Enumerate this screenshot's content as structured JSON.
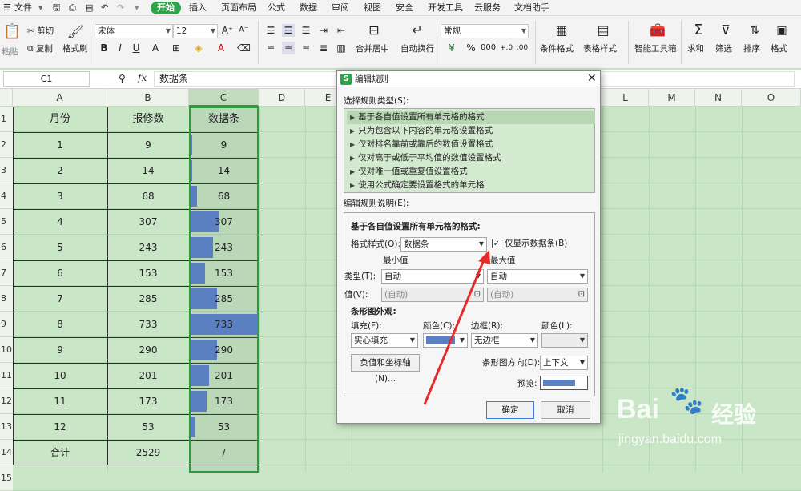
{
  "menu": {
    "file": "文件",
    "tabs": [
      "开始",
      "插入",
      "页面布局",
      "公式",
      "数据",
      "审阅",
      "视图",
      "安全",
      "开发工具",
      "云服务",
      "文档助手"
    ]
  },
  "ribbon": {
    "paste": "粘贴",
    "cut": "剪切",
    "copy": "复制",
    "format_painter": "格式刷",
    "font_name": "宋体",
    "font_size": "12",
    "merge_center": "合并居中",
    "wrap_text": "自动换行",
    "number_format": "常规",
    "conditional_format": "条件格式",
    "table_style": "表格样式",
    "smart_toolbox": "智能工具箱",
    "sum": "求和",
    "filter": "筛选",
    "sort": "排序",
    "format": "格式"
  },
  "formula_bar": {
    "cell_ref": "C1",
    "fx": "fx",
    "content": "数据条"
  },
  "sheet": {
    "columns": [
      "A",
      "B",
      "C",
      "D",
      "E",
      "L",
      "M",
      "N",
      "O"
    ],
    "rows": [
      "1",
      "2",
      "3",
      "4",
      "5",
      "6",
      "7",
      "8",
      "9",
      "10",
      "11",
      "12",
      "13",
      "14",
      "15"
    ],
    "headers": [
      "月份",
      "报修数",
      "数据条"
    ],
    "data": [
      {
        "month": "1",
        "count": "9",
        "bar": "9",
        "fill": 0.012
      },
      {
        "month": "2",
        "count": "14",
        "bar": "14",
        "fill": 0.019
      },
      {
        "month": "3",
        "count": "68",
        "bar": "68",
        "fill": 0.093
      },
      {
        "month": "4",
        "count": "307",
        "bar": "307",
        "fill": 0.419
      },
      {
        "month": "5",
        "count": "243",
        "bar": "243",
        "fill": 0.332
      },
      {
        "month": "6",
        "count": "153",
        "bar": "153",
        "fill": 0.209
      },
      {
        "month": "7",
        "count": "285",
        "bar": "285",
        "fill": 0.389
      },
      {
        "month": "8",
        "count": "733",
        "bar": "733",
        "fill": 1.0
      },
      {
        "month": "9",
        "count": "290",
        "bar": "290",
        "fill": 0.396
      },
      {
        "month": "10",
        "count": "201",
        "bar": "201",
        "fill": 0.274
      },
      {
        "month": "11",
        "count": "173",
        "bar": "173",
        "fill": 0.236
      },
      {
        "month": "12",
        "count": "53",
        "bar": "53",
        "fill": 0.072
      }
    ],
    "total": {
      "label": "合计",
      "count": "2529",
      "bar": "/"
    }
  },
  "dialog": {
    "title": "编辑规则",
    "select_rule_type": "选择规则类型(S):",
    "rules": [
      "基于各自值设置所有单元格的格式",
      "只为包含以下内容的单元格设置格式",
      "仅对排名靠前或靠后的数值设置格式",
      "仅对高于或低于平均值的数值设置格式",
      "仅对唯一值或重复值设置格式",
      "使用公式确定要设置格式的单元格"
    ],
    "edit_rule_desc": "编辑规则说明(E):",
    "section_title": "基于各自值设置所有单元格的格式:",
    "format_style_label": "格式样式(O):",
    "format_style_value": "数据条",
    "show_bar_only": "仅显示数据条(B)",
    "min_label": "最小值",
    "max_label": "最大值",
    "type_label": "类型(T):",
    "type_min": "自动",
    "type_max": "自动",
    "value_label": "值(V):",
    "value_min": "(自动)",
    "value_max": "(自动)",
    "bar_appearance": "条形图外观:",
    "fill_label": "填充(F):",
    "fill_value": "实心填充",
    "color_label_1": "颜色(C):",
    "border_label": "边框(R):",
    "border_value": "无边框",
    "color_label_2": "颜色(L):",
    "neg_axis_button": "负值和坐标轴(N)...",
    "bar_direction_label": "条形图方向(D):",
    "bar_direction_value": "上下文",
    "preview_label": "预览:",
    "ok": "确定",
    "cancel": "取消",
    "bar_color": "#5b80c2"
  },
  "watermark": {
    "brand": "Bai",
    "brand2": "经验",
    "url": "jingyan.baidu.com"
  }
}
